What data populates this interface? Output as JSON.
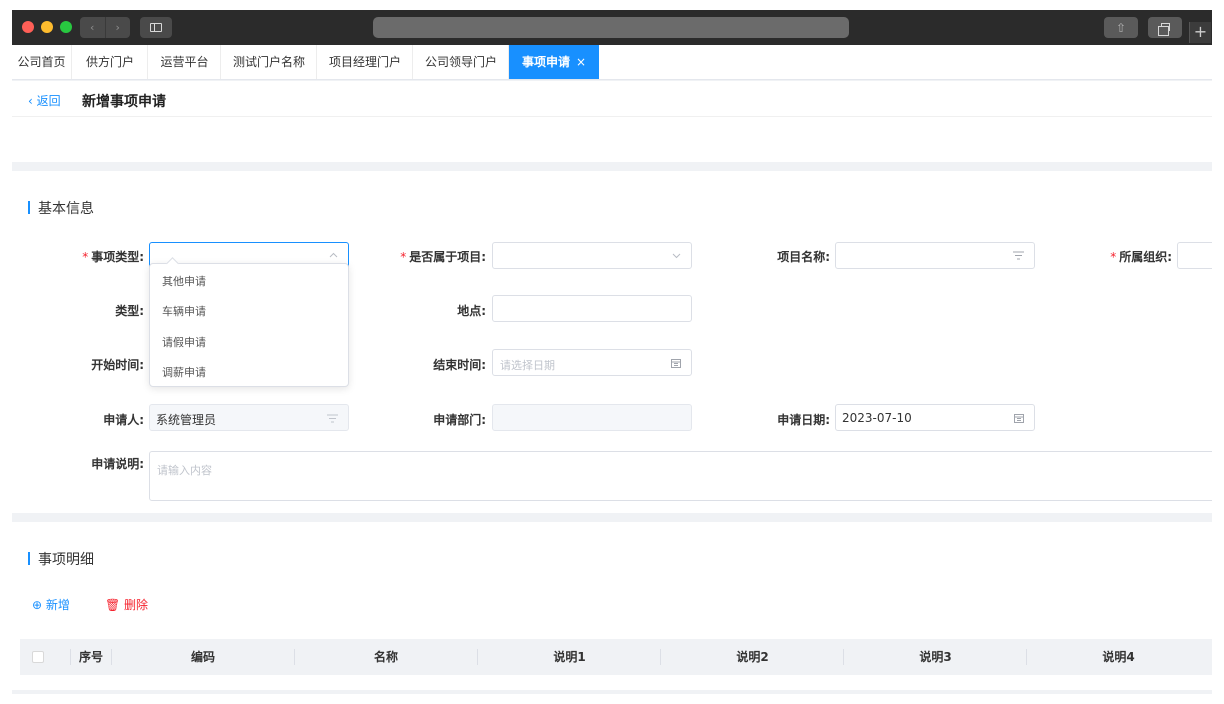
{
  "browser": {
    "nav_back": "‹",
    "nav_forward": "›",
    "share_icon": "⇧",
    "new_tab": "+"
  },
  "tabs": [
    {
      "label": "公司首页"
    },
    {
      "label": "供方门户"
    },
    {
      "label": "运营平台"
    },
    {
      "label": "测试门户名称"
    },
    {
      "label": "项目经理门户"
    },
    {
      "label": "公司领导门户"
    },
    {
      "label": "事项申请",
      "close": "×",
      "active": true
    }
  ],
  "header": {
    "back_label": "‹ 返回",
    "title": "新增事项申请"
  },
  "basic_info": {
    "section_title": "基本信息",
    "item_type": {
      "label": "事项类型:",
      "value": "",
      "required": "*",
      "icon": "chevron-up-icon"
    },
    "is_project": {
      "label": "是否属于项目:",
      "value": "",
      "required": "*",
      "icon": "chevron-down-icon"
    },
    "project_name": {
      "label": "项目名称:",
      "value": "",
      "icon": "filter-icon"
    },
    "org": {
      "label": "所属组织:",
      "value": "",
      "required": "*"
    },
    "type": {
      "label": "类型:",
      "value": ""
    },
    "location": {
      "label": "地点:",
      "value": ""
    },
    "start_time": {
      "label": "开始时间:",
      "value": ""
    },
    "end_time": {
      "label": "结束时间:",
      "placeholder": "请选择日期",
      "icon": "calendar-icon"
    },
    "applicant": {
      "label": "申请人:",
      "value": "系统管理员",
      "icon": "filter-icon"
    },
    "department": {
      "label": "申请部门:",
      "value": ""
    },
    "apply_date": {
      "label": "申请日期:",
      "value": "2023-07-10",
      "icon": "calendar-icon"
    },
    "description": {
      "label": "申请说明:",
      "placeholder": "请输入内容"
    }
  },
  "item_type_options": [
    "其他申请",
    "车辆申请",
    "请假申请",
    "调薪申请"
  ],
  "details": {
    "section_title": "事项明细",
    "add_label": "⊕ 新增",
    "delete_label": "🗑 删除",
    "columns": [
      "序号",
      "编码",
      "名称",
      "说明1",
      "说明2",
      "说明3",
      "说明4"
    ]
  },
  "colors": {
    "accent": "#1890ff",
    "danger": "#f5222d"
  }
}
